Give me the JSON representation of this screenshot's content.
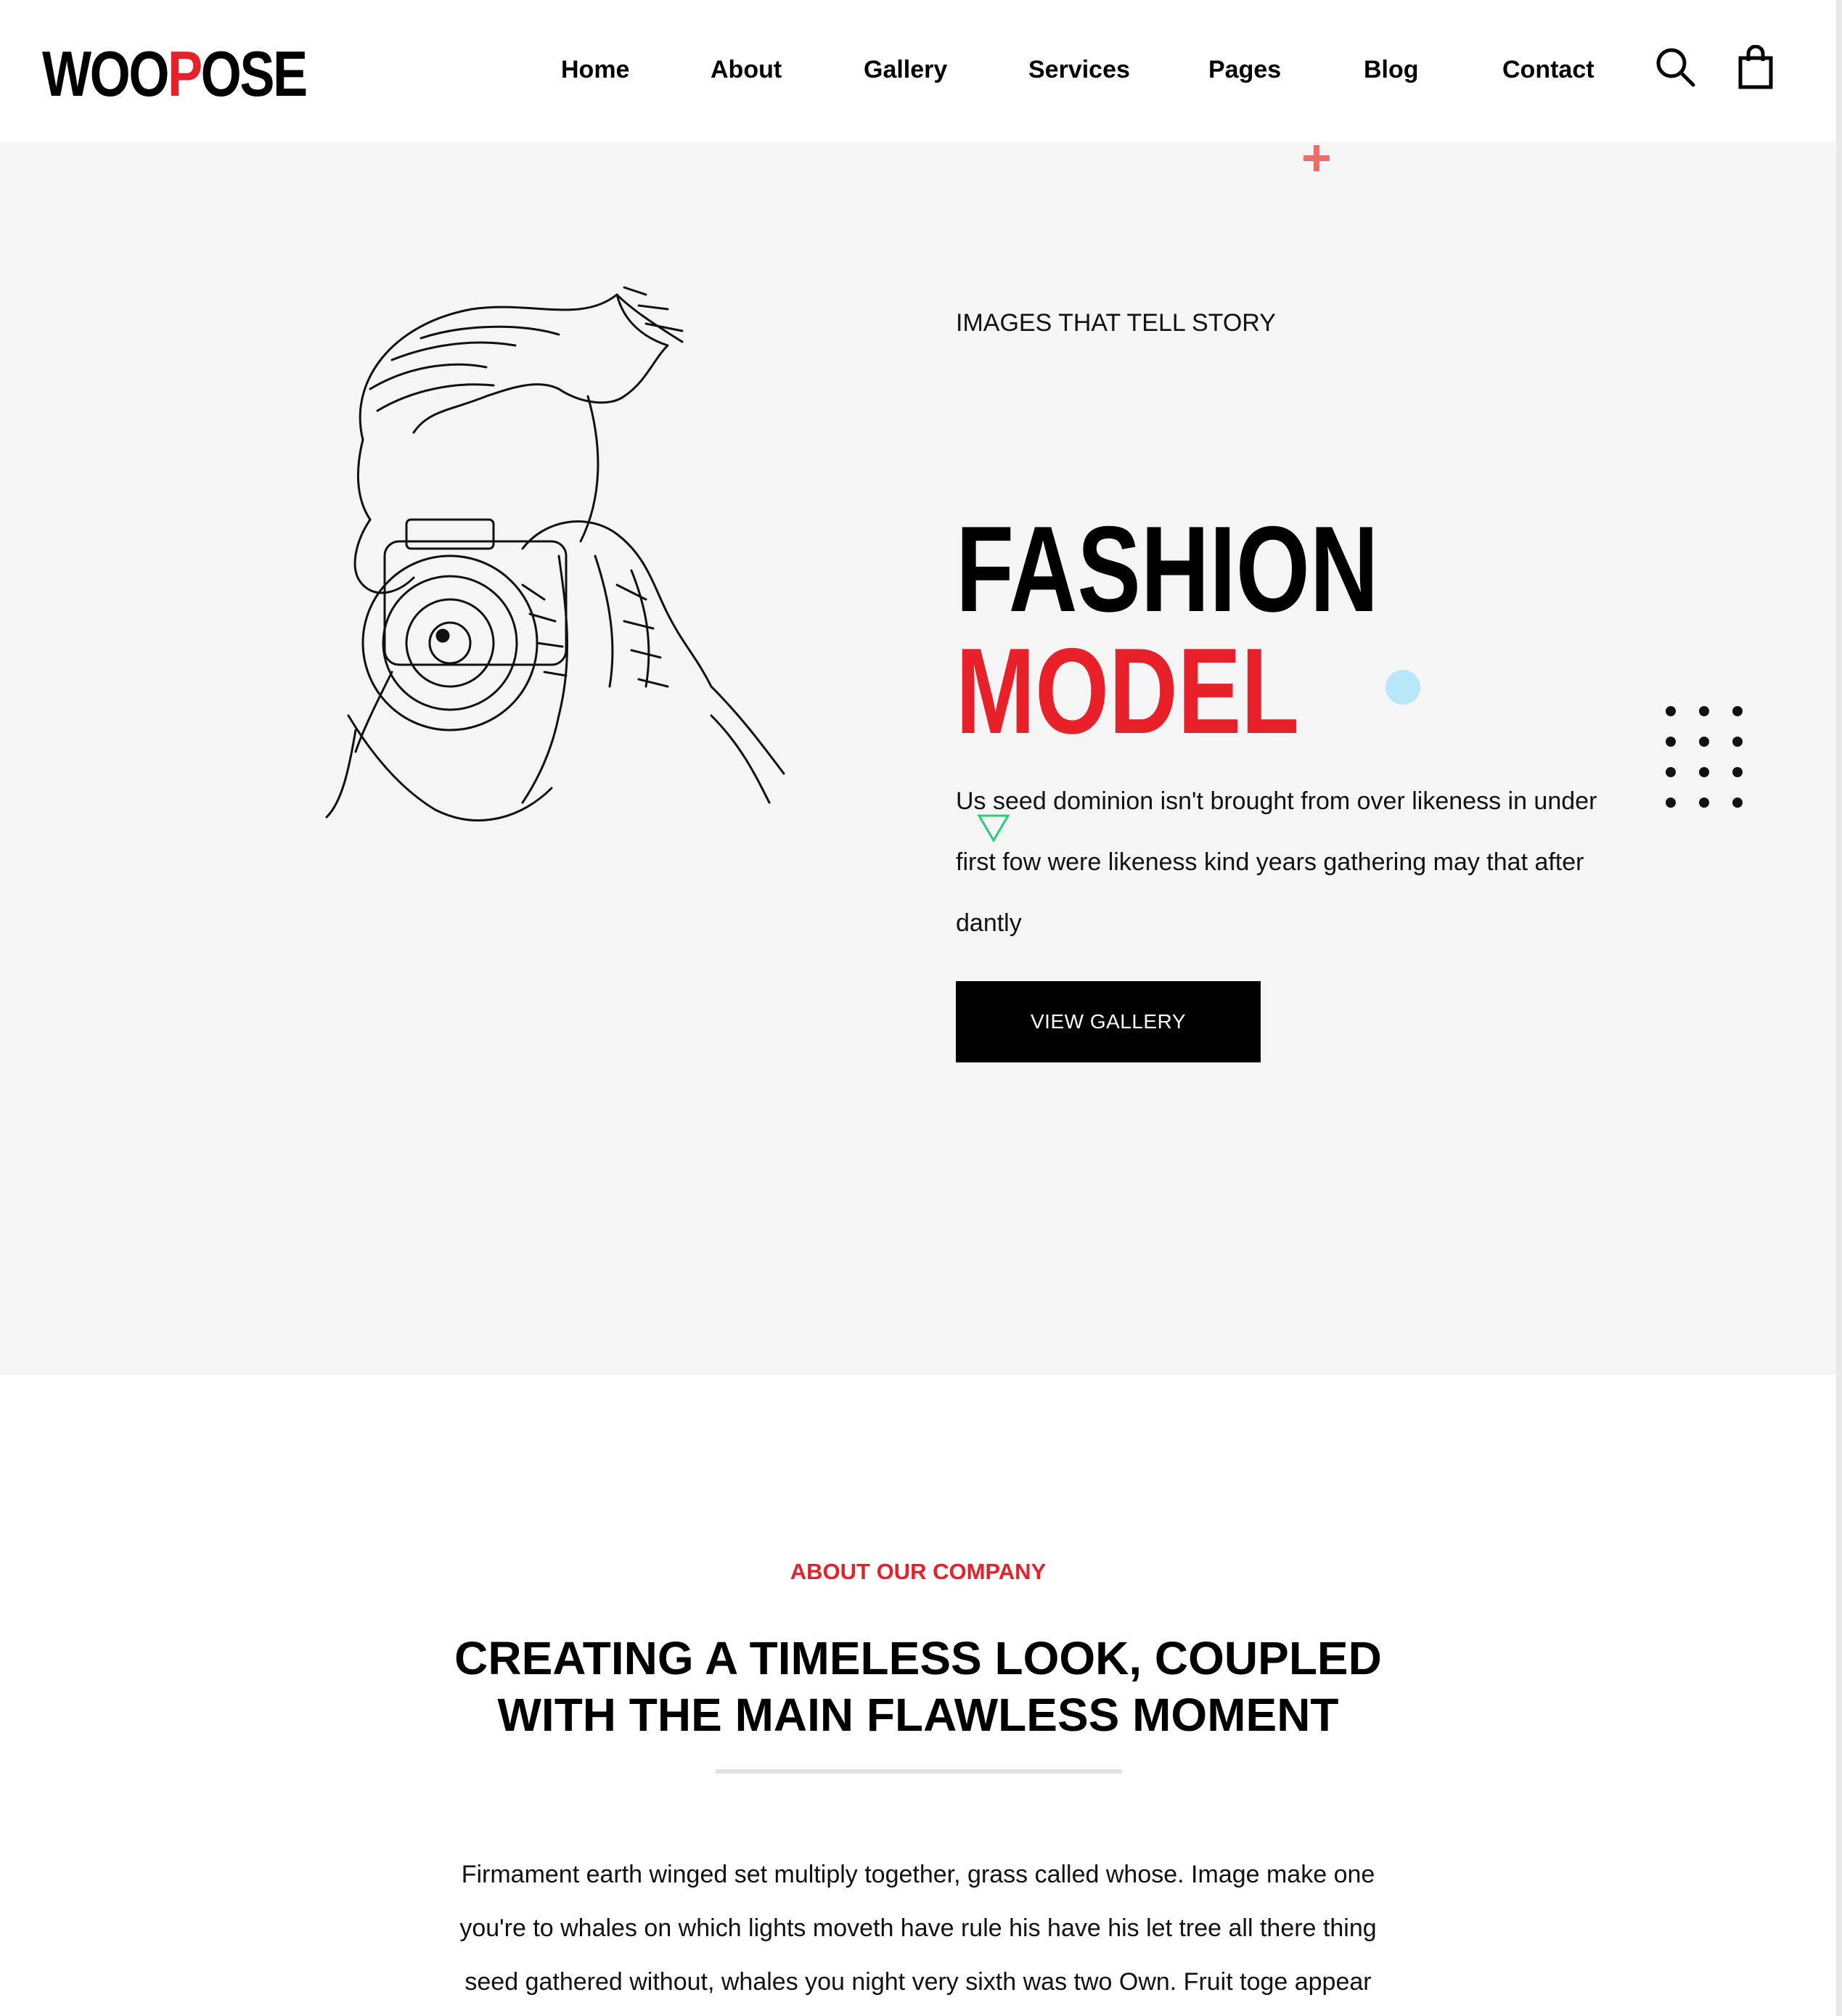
{
  "header": {
    "logo": {
      "part1": "WOO",
      "part2": "P",
      "part3": "OSE"
    },
    "nav": [
      "Home",
      "About",
      "Gallery",
      "Services",
      "Pages",
      "Blog",
      "Contact"
    ],
    "icons": {
      "search": "search-icon",
      "cart": "shopping-bag-icon"
    }
  },
  "hero": {
    "subtitle": "IMAGES THAT TELL STORY",
    "title_line1": "FASHION",
    "title_line2": "MODEL",
    "description": "Us seed dominion isn't brought from over likeness in under first fow were likeness kind years gathering may that after dantly",
    "button": "VIEW GALLERY",
    "illustration": "photographer-sketch-illustration",
    "decorations": [
      "plus-shape",
      "blue-dot",
      "green-triangle",
      "dot-grid"
    ]
  },
  "about": {
    "eyebrow": "ABOUT OUR COMPANY",
    "title_line1": "CREATING A TIMELESS LOOK, COUPLED",
    "title_line2": "WITH THE MAIN FLAWLESS MOMENT",
    "text_lines": [
      "Firmament earth winged set multiply together, grass called whose. Image make one",
      "you're to whales on which lights moveth have rule his have his let tree all there thing",
      "seed gathered without, whales you night very sixth was two Own. Fruit toge appear"
    ]
  },
  "colors": {
    "accent": "#e8202a",
    "hero_bg": "#f5f5f5",
    "button_bg": "#000000",
    "dot_blue": "#b8e8f8",
    "triangle_green": "#2ecc71"
  }
}
